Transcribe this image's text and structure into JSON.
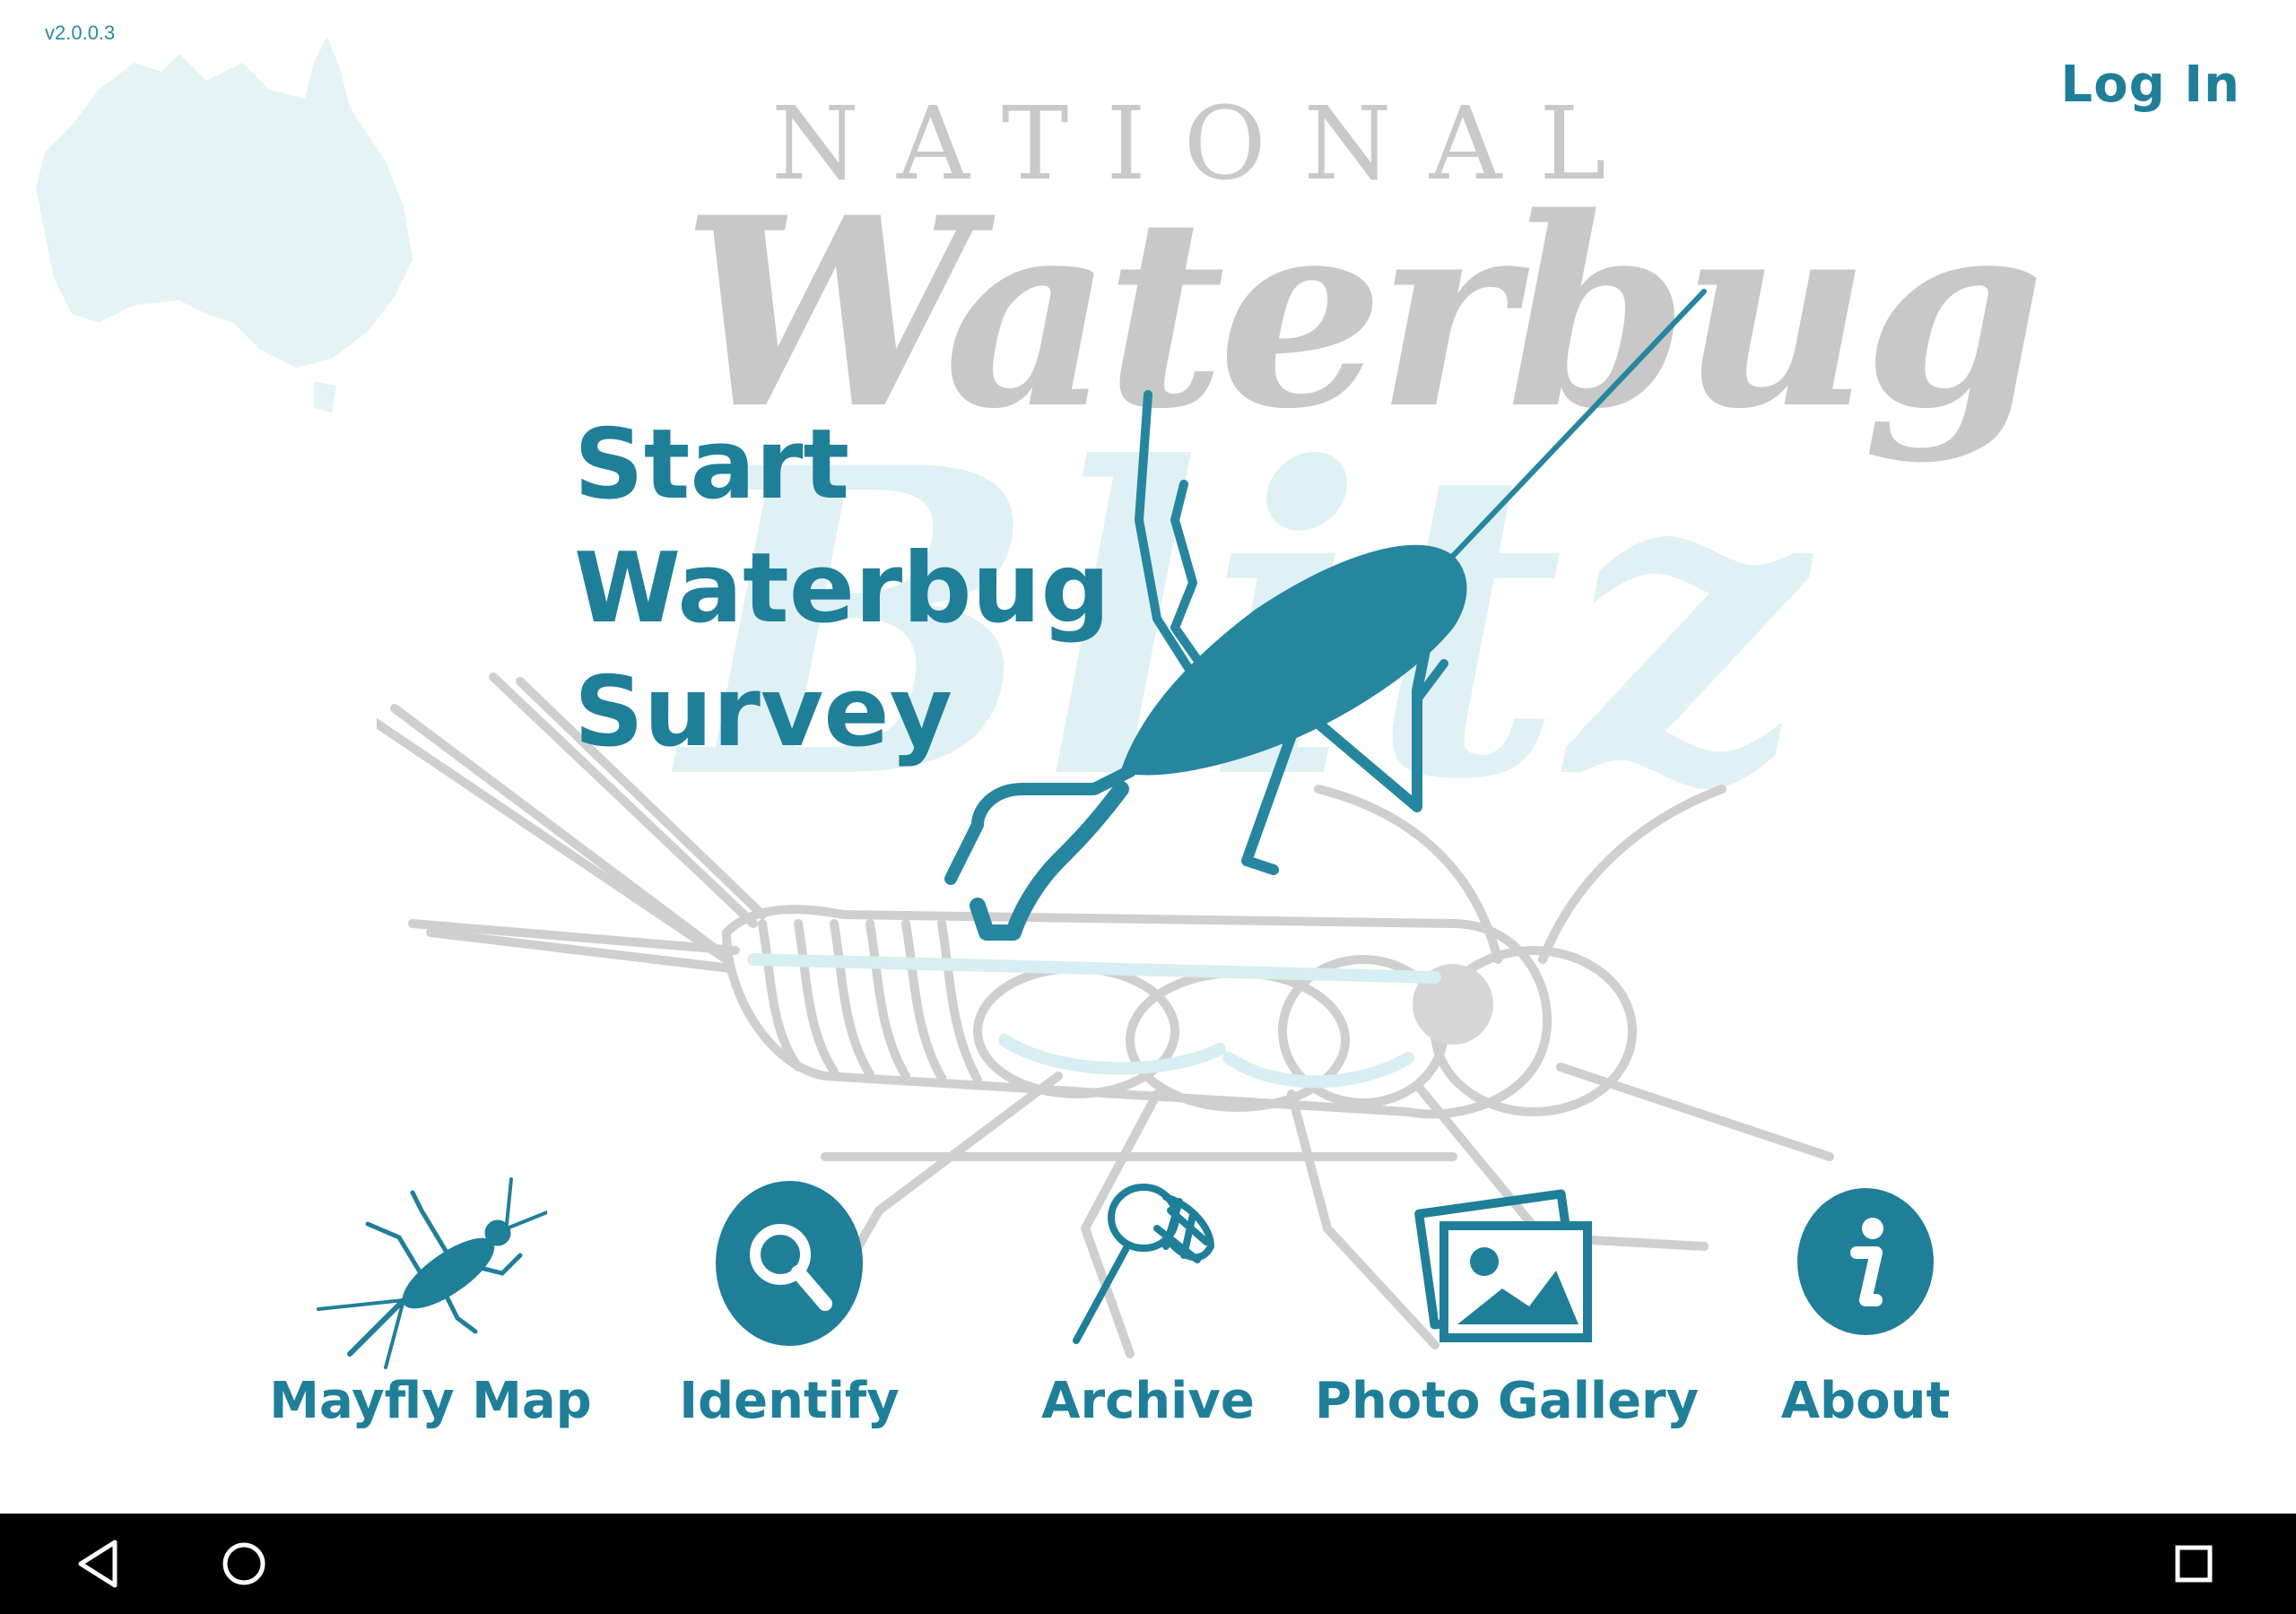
{
  "app": {
    "version": "v2.0.0.3",
    "login_label": "Log In",
    "logo": {
      "national": "NATIONAL",
      "waterbug": "Waterbug",
      "blitz": "Blitz"
    },
    "start_survey": {
      "line1": "Start",
      "line2": "Waterbug",
      "line3": "Survey"
    }
  },
  "nav": [
    {
      "label": "Mayfly Map",
      "icon": "mayfly-icon"
    },
    {
      "label": "Identify",
      "icon": "magnifier-icon"
    },
    {
      "label": "Archive",
      "icon": "net-icon"
    },
    {
      "label": "Photo Gallery",
      "icon": "photo-gallery-icon"
    },
    {
      "label": "About",
      "icon": "info-icon"
    }
  ],
  "system_nav": {
    "back": "back-icon",
    "home": "home-icon",
    "recents": "recents-icon"
  },
  "colors": {
    "accent": "#1f7f99",
    "logo_grey": "#c8c8c8",
    "light_blue": "#dff1f4",
    "navbar": "#000000"
  }
}
